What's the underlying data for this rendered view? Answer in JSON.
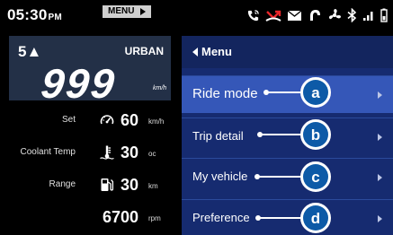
{
  "status_bar": {
    "time": "05:30",
    "ampm": "PM",
    "menu_tab_label": "MENU",
    "icons": [
      "phone-icon",
      "missed-call-icon",
      "message-icon",
      "headset-icon",
      "fan-icon",
      "bluetooth-icon",
      "signal-icon",
      "battery-icon"
    ]
  },
  "speed_panel": {
    "gear": "5▲",
    "mode": "URBAN",
    "speed": "999",
    "unit": "km/h"
  },
  "info": {
    "set": {
      "label": "Set",
      "value": "60",
      "unit": "km/h",
      "icon": "cruise-control-icon"
    },
    "coolant": {
      "label": "Coolant Temp",
      "value": "30",
      "unit": "oc",
      "icon": "thermometer-icon"
    },
    "range": {
      "label": "Range",
      "value": "30",
      "unit": "km",
      "icon": "fuel-pump-icon"
    },
    "rpm": {
      "value": "6700",
      "unit": "rpm"
    }
  },
  "menu": {
    "title": "Menu",
    "items": [
      {
        "label": "Ride mode",
        "callout": "a"
      },
      {
        "label": "Trip detail",
        "callout": "b"
      },
      {
        "label": "My vehicle",
        "callout": "c"
      },
      {
        "label": "Preference",
        "callout": "d"
      }
    ]
  },
  "colors": {
    "background": "#000000",
    "speed_panel": "#233047",
    "menu_panel": "#162b70",
    "menu_selected": "#3557b8",
    "callout_fill": "#0d5aa7"
  }
}
